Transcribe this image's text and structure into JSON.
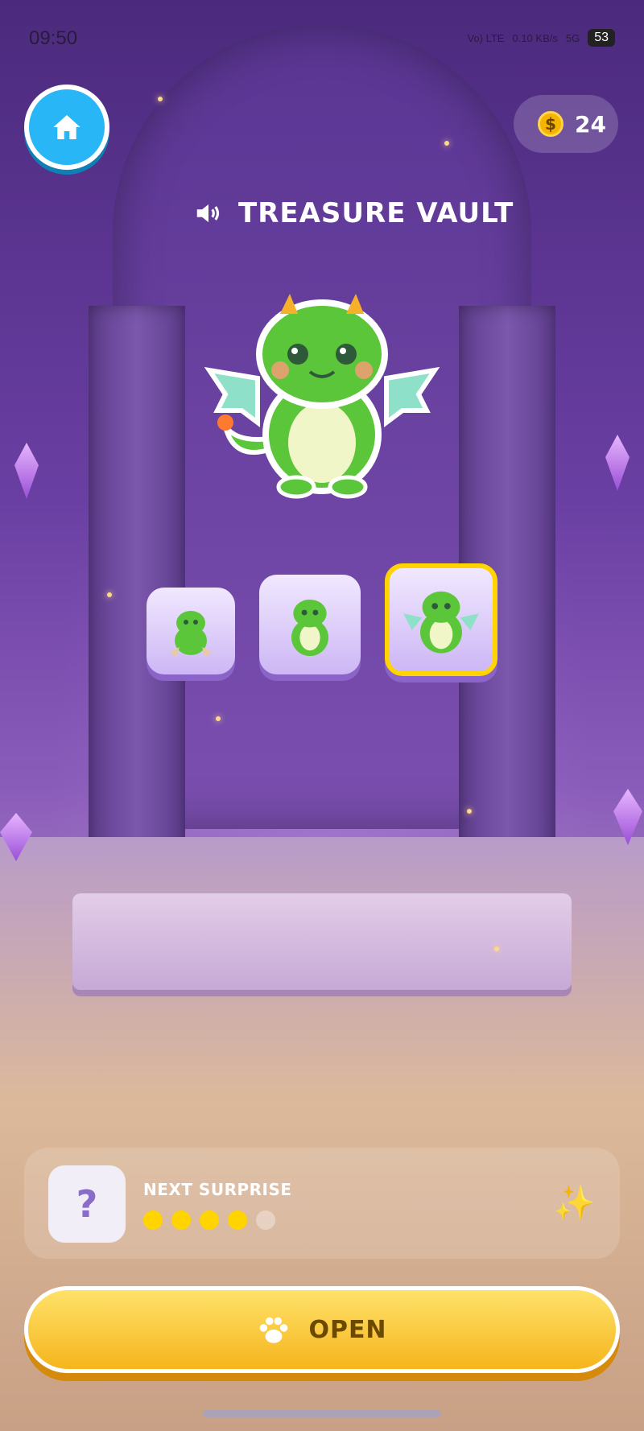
{
  "status_bar": {
    "time": "09:50",
    "network": "Vo) LTE",
    "speed": "0.10 KB/s",
    "signal": "5G",
    "battery": "53"
  },
  "header": {
    "home_icon": "home-icon",
    "coins": "24",
    "coin_icon": "dollar-coin-icon"
  },
  "title": {
    "text": "TREASURE VAULT",
    "icon": "speaker-icon"
  },
  "thumbnails": [
    {
      "name": "hatchling-dragon",
      "selected": false
    },
    {
      "name": "sitting-dragon",
      "selected": false
    },
    {
      "name": "winged-dragon",
      "selected": true
    }
  ],
  "surprise": {
    "question_mark": "?",
    "label": "NEXT SURPRISE",
    "progress_filled": 4,
    "progress_total": 5,
    "sparkle": "✨"
  },
  "open_button": {
    "label": "OPEN",
    "icon": "paw-icon"
  },
  "colors": {
    "accent": "#ffd400",
    "home": "#29b6f6",
    "button": "#f5b51d",
    "dragon": "#5cc63a"
  }
}
